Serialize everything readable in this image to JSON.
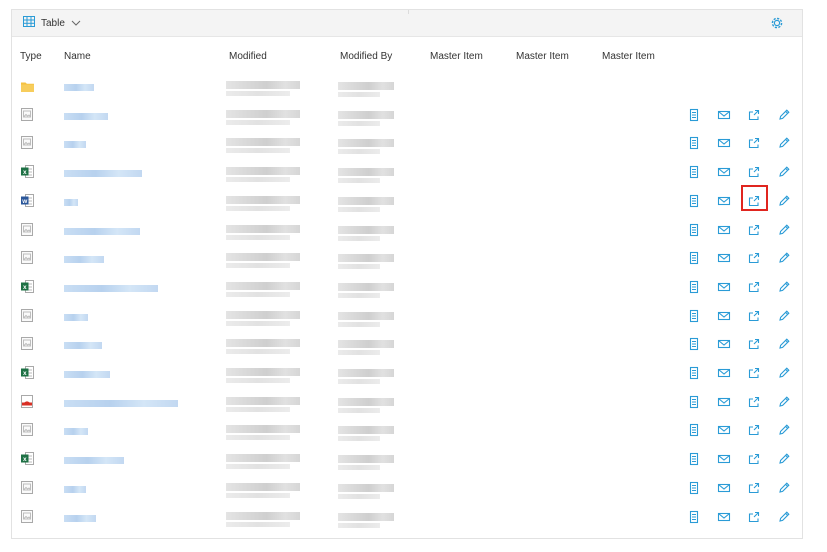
{
  "toolbar": {
    "view_label": "Table"
  },
  "columns": [
    "Type",
    "Name",
    "Modified",
    "Modified By",
    "Master Item",
    "Master Item",
    "Master Item"
  ],
  "rows": [
    {
      "type": "folder",
      "actions": false
    },
    {
      "type": "image",
      "actions": true
    },
    {
      "type": "image",
      "actions": true
    },
    {
      "type": "excel",
      "actions": true
    },
    {
      "type": "word",
      "actions": true
    },
    {
      "type": "image",
      "actions": true
    },
    {
      "type": "image",
      "actions": true
    },
    {
      "type": "excel",
      "actions": true
    },
    {
      "type": "image",
      "actions": true
    },
    {
      "type": "image",
      "actions": true
    },
    {
      "type": "excel",
      "actions": true
    },
    {
      "type": "pdf",
      "actions": true
    },
    {
      "type": "image",
      "actions": true
    },
    {
      "type": "excel",
      "actions": true
    },
    {
      "type": "image",
      "actions": true
    },
    {
      "type": "image",
      "actions": true
    }
  ],
  "icons": {
    "table": "table-grid-icon",
    "chevron": "chevron-down-icon",
    "gear": "gear-icon",
    "actions": [
      "document-icon",
      "mail-icon",
      "share-icon",
      "edit-pencil-icon"
    ]
  },
  "colors": {
    "accent": "#2a9bd6",
    "excel": "#1e7145",
    "word": "#2b579a",
    "pdf": "#d93025",
    "folder": "#f5c242",
    "highlight": "#e0251f"
  }
}
